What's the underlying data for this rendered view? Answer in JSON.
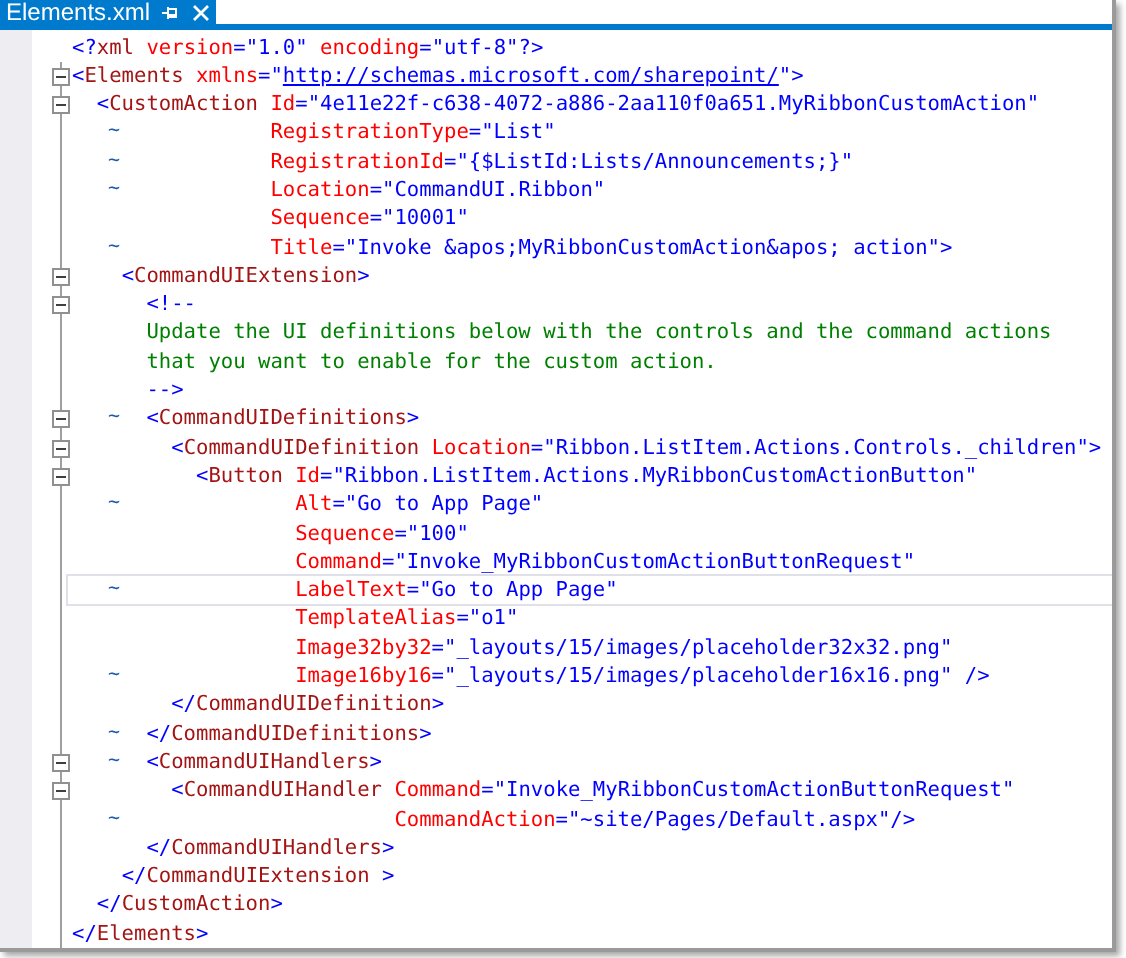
{
  "tab": {
    "label": "Elements.xml",
    "selected": true
  },
  "lines": [
    {
      "fold": false,
      "current": false,
      "segments": [
        {
          "kind": "punct",
          "text": "<?"
        },
        {
          "kind": "tag",
          "text": "xml"
        },
        {
          "kind": "attr",
          "text": " version"
        },
        {
          "kind": "punct",
          "text": "="
        },
        {
          "kind": "value",
          "text": "\"1.0\""
        },
        {
          "kind": "attr",
          "text": " encoding"
        },
        {
          "kind": "punct",
          "text": "="
        },
        {
          "kind": "value",
          "text": "\"utf-8\""
        },
        {
          "kind": "punct",
          "text": "?>"
        }
      ]
    },
    {
      "fold": true,
      "current": false,
      "segments": [
        {
          "kind": "punct",
          "text": "<"
        },
        {
          "kind": "tag",
          "text": "Elements"
        },
        {
          "kind": "attr",
          "text": " xmlns"
        },
        {
          "kind": "punct",
          "text": "=\""
        },
        {
          "kind": "link",
          "text": "http://schemas.microsoft.com/sharepoint/"
        },
        {
          "kind": "punct",
          "text": "\">"
        }
      ]
    },
    {
      "fold": true,
      "current": false,
      "segments": [
        {
          "kind": "punct",
          "text": "  <"
        },
        {
          "kind": "tag",
          "text": "CustomAction"
        },
        {
          "kind": "attr",
          "text": " Id"
        },
        {
          "kind": "punct",
          "text": "="
        },
        {
          "kind": "value",
          "text": "\"4e11e22f-c638-4072-a886-2aa110f0a651.MyRibbonCustomAction\""
        }
      ]
    },
    {
      "fold": false,
      "current": false,
      "marker": "~",
      "segments": [
        {
          "kind": "attr",
          "text": "                RegistrationType"
        },
        {
          "kind": "punct",
          "text": "="
        },
        {
          "kind": "value",
          "text": "\"List\""
        }
      ]
    },
    {
      "fold": false,
      "current": false,
      "marker": "~",
      "segments": [
        {
          "kind": "attr",
          "text": "                RegistrationId"
        },
        {
          "kind": "punct",
          "text": "="
        },
        {
          "kind": "value",
          "text": "\"{$ListId:Lists/Announcements;}\""
        }
      ]
    },
    {
      "fold": false,
      "current": false,
      "marker": "~",
      "segments": [
        {
          "kind": "attr",
          "text": "                Location"
        },
        {
          "kind": "punct",
          "text": "="
        },
        {
          "kind": "value",
          "text": "\"CommandUI.Ribbon\""
        }
      ]
    },
    {
      "fold": false,
      "current": false,
      "segments": [
        {
          "kind": "attr",
          "text": "                Sequence"
        },
        {
          "kind": "punct",
          "text": "="
        },
        {
          "kind": "value",
          "text": "\"10001\""
        }
      ]
    },
    {
      "fold": false,
      "current": false,
      "marker": "~",
      "segments": [
        {
          "kind": "attr",
          "text": "                Title"
        },
        {
          "kind": "punct",
          "text": "="
        },
        {
          "kind": "value",
          "text": "\"Invoke &apos;MyRibbonCustomAction&apos; action\""
        },
        {
          "kind": "punct",
          "text": ">"
        }
      ]
    },
    {
      "fold": true,
      "current": false,
      "segments": [
        {
          "kind": "punct",
          "text": "    <"
        },
        {
          "kind": "tag",
          "text": "CommandUIExtension"
        },
        {
          "kind": "punct",
          "text": ">"
        }
      ]
    },
    {
      "fold": true,
      "current": false,
      "segments": [
        {
          "kind": "punct",
          "text": "      <!--"
        }
      ]
    },
    {
      "fold": false,
      "current": false,
      "segments": [
        {
          "kind": "comment",
          "text": "      Update the UI definitions below with the controls and the command actions"
        }
      ]
    },
    {
      "fold": false,
      "current": false,
      "segments": [
        {
          "kind": "comment",
          "text": "      that you want to enable for the custom action."
        }
      ]
    },
    {
      "fold": false,
      "current": false,
      "segments": [
        {
          "kind": "punct",
          "text": "      -->"
        }
      ]
    },
    {
      "fold": true,
      "current": false,
      "marker": "~",
      "segments": [
        {
          "kind": "punct",
          "text": "      <"
        },
        {
          "kind": "tag",
          "text": "CommandUIDefinitions"
        },
        {
          "kind": "punct",
          "text": ">"
        }
      ]
    },
    {
      "fold": true,
      "current": false,
      "segments": [
        {
          "kind": "punct",
          "text": "        <"
        },
        {
          "kind": "tag",
          "text": "CommandUIDefinition"
        },
        {
          "kind": "attr",
          "text": " Location"
        },
        {
          "kind": "punct",
          "text": "="
        },
        {
          "kind": "value",
          "text": "\"Ribbon.ListItem.Actions.Controls._children\""
        },
        {
          "kind": "punct",
          "text": ">"
        }
      ]
    },
    {
      "fold": true,
      "current": false,
      "segments": [
        {
          "kind": "punct",
          "text": "          <"
        },
        {
          "kind": "tag",
          "text": "Button"
        },
        {
          "kind": "attr",
          "text": " Id"
        },
        {
          "kind": "punct",
          "text": "="
        },
        {
          "kind": "value",
          "text": "\"Ribbon.ListItem.Actions.MyRibbonCustomActionButton\""
        }
      ]
    },
    {
      "fold": false,
      "current": false,
      "marker": "~",
      "segments": [
        {
          "kind": "attr",
          "text": "                  Alt"
        },
        {
          "kind": "punct",
          "text": "="
        },
        {
          "kind": "value",
          "text": "\"Go to App Page\""
        }
      ]
    },
    {
      "fold": false,
      "current": false,
      "segments": [
        {
          "kind": "attr",
          "text": "                  Sequence"
        },
        {
          "kind": "punct",
          "text": "="
        },
        {
          "kind": "value",
          "text": "\"100\""
        }
      ]
    },
    {
      "fold": false,
      "current": false,
      "segments": [
        {
          "kind": "attr",
          "text": "                  Command"
        },
        {
          "kind": "punct",
          "text": "="
        },
        {
          "kind": "value",
          "text": "\"Invoke_MyRibbonCustomActionButtonRequest\""
        }
      ]
    },
    {
      "fold": false,
      "current": true,
      "marker": "~",
      "segments": [
        {
          "kind": "attr",
          "text": "                  LabelText"
        },
        {
          "kind": "punct",
          "text": "="
        },
        {
          "kind": "value",
          "text": "\"Go to App Page\""
        }
      ]
    },
    {
      "fold": false,
      "current": false,
      "segments": [
        {
          "kind": "attr",
          "text": "                  TemplateAlias"
        },
        {
          "kind": "punct",
          "text": "="
        },
        {
          "kind": "value",
          "text": "\"o1\""
        }
      ]
    },
    {
      "fold": false,
      "current": false,
      "segments": [
        {
          "kind": "attr",
          "text": "                  Image32by32"
        },
        {
          "kind": "punct",
          "text": "="
        },
        {
          "kind": "value",
          "text": "\"_layouts/15/images/placeholder32x32.png\""
        }
      ]
    },
    {
      "fold": false,
      "current": false,
      "marker": "~",
      "segments": [
        {
          "kind": "attr",
          "text": "                  Image16by16"
        },
        {
          "kind": "punct",
          "text": "="
        },
        {
          "kind": "value",
          "text": "\"_layouts/15/images/placeholder16x16.png\""
        },
        {
          "kind": "punct",
          "text": " />"
        }
      ]
    },
    {
      "fold": false,
      "current": false,
      "segments": [
        {
          "kind": "punct",
          "text": "        </"
        },
        {
          "kind": "tag",
          "text": "CommandUIDefinition"
        },
        {
          "kind": "punct",
          "text": ">"
        }
      ]
    },
    {
      "fold": false,
      "current": false,
      "marker": "~",
      "segments": [
        {
          "kind": "punct",
          "text": "      </"
        },
        {
          "kind": "tag",
          "text": "CommandUIDefinitions"
        },
        {
          "kind": "punct",
          "text": ">"
        }
      ]
    },
    {
      "fold": true,
      "current": false,
      "marker": "~",
      "segments": [
        {
          "kind": "punct",
          "text": "      <"
        },
        {
          "kind": "tag",
          "text": "CommandUIHandlers"
        },
        {
          "kind": "punct",
          "text": ">"
        }
      ]
    },
    {
      "fold": true,
      "current": false,
      "segments": [
        {
          "kind": "punct",
          "text": "        <"
        },
        {
          "kind": "tag",
          "text": "CommandUIHandler"
        },
        {
          "kind": "attr",
          "text": " Command"
        },
        {
          "kind": "punct",
          "text": "="
        },
        {
          "kind": "value",
          "text": "\"Invoke_MyRibbonCustomActionButtonRequest\""
        }
      ]
    },
    {
      "fold": false,
      "current": false,
      "marker": "~",
      "segments": [
        {
          "kind": "attr",
          "text": "                          CommandAction"
        },
        {
          "kind": "punct",
          "text": "="
        },
        {
          "kind": "value",
          "text": "\"~site/Pages/Default.aspx\""
        },
        {
          "kind": "punct",
          "text": "/>"
        }
      ]
    },
    {
      "fold": false,
      "current": false,
      "segments": [
        {
          "kind": "punct",
          "text": "      </"
        },
        {
          "kind": "tag",
          "text": "CommandUIHandlers"
        },
        {
          "kind": "punct",
          "text": ">"
        }
      ]
    },
    {
      "fold": false,
      "current": false,
      "segments": [
        {
          "kind": "punct",
          "text": "    </"
        },
        {
          "kind": "tag",
          "text": "CommandUIExtension"
        },
        {
          "kind": "punct",
          "text": " >"
        }
      ]
    },
    {
      "fold": false,
      "current": false,
      "segments": [
        {
          "kind": "punct",
          "text": "  </"
        },
        {
          "kind": "tag",
          "text": "CustomAction"
        },
        {
          "kind": "punct",
          "text": ">"
        }
      ]
    },
    {
      "fold": false,
      "current": false,
      "segments": [
        {
          "kind": "punct",
          "text": "</"
        },
        {
          "kind": "tag",
          "text": "Elements"
        },
        {
          "kind": "punct",
          "text": ">"
        }
      ]
    }
  ]
}
